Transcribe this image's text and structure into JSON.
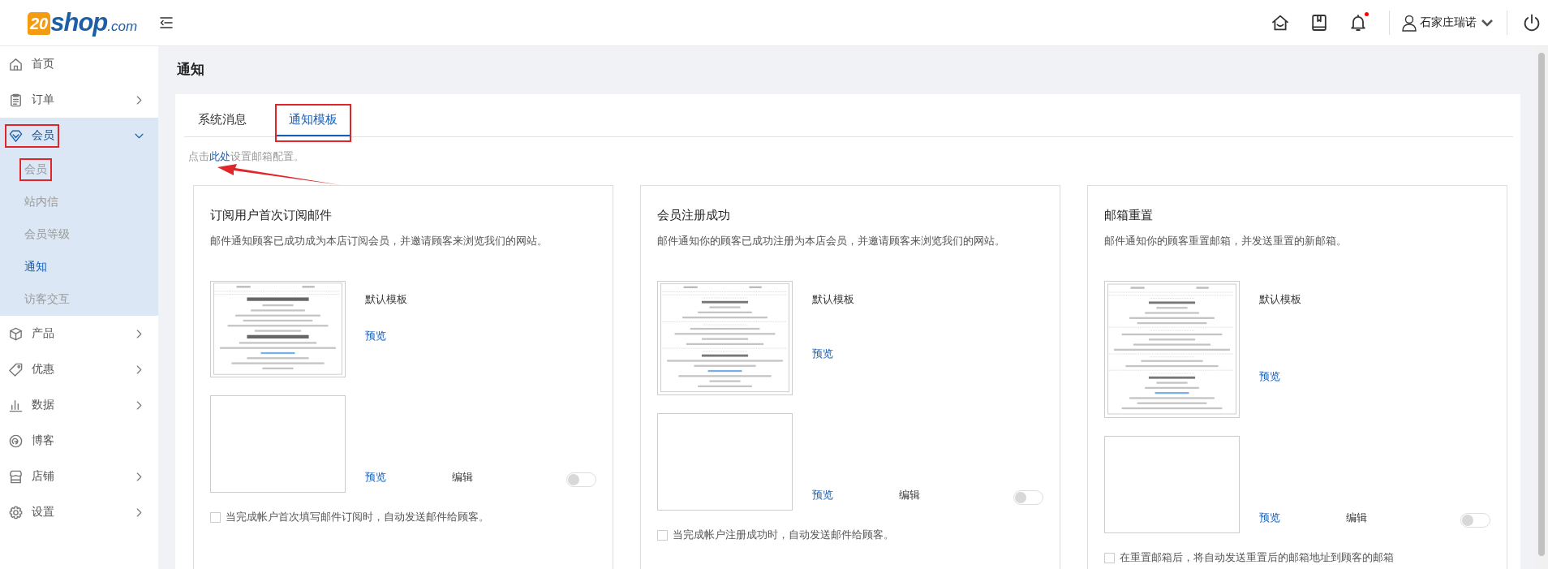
{
  "header": {
    "logo": {
      "badge": "20",
      "name": "shop",
      "suffix": ".com"
    },
    "notifications_unread": true,
    "user": "石家庄瑞诺"
  },
  "sidebar": {
    "items": [
      {
        "label": "首页",
        "expandable": false,
        "expanded": false,
        "marked": false
      },
      {
        "label": "订单",
        "expandable": true,
        "expanded": false,
        "marked": false
      },
      {
        "label": "会员",
        "expandable": true,
        "expanded": true,
        "marked": true,
        "children": [
          {
            "label": "会员",
            "selected": false,
            "marked": true
          },
          {
            "label": "站内信",
            "selected": false,
            "marked": false
          },
          {
            "label": "会员等级",
            "selected": false,
            "marked": false
          },
          {
            "label": "通知",
            "selected": true,
            "marked": false
          },
          {
            "label": "访客交互",
            "selected": false,
            "marked": false
          }
        ]
      },
      {
        "label": "产品",
        "expandable": true,
        "expanded": false,
        "marked": false
      },
      {
        "label": "优惠",
        "expandable": true,
        "expanded": false,
        "marked": false
      },
      {
        "label": "数据",
        "expandable": true,
        "expanded": false,
        "marked": false
      },
      {
        "label": "博客",
        "expandable": false,
        "expanded": false,
        "marked": false
      },
      {
        "label": "店铺",
        "expandable": true,
        "expanded": false,
        "marked": false
      },
      {
        "label": "设置",
        "expandable": true,
        "expanded": false,
        "marked": false
      }
    ]
  },
  "page": {
    "title": "通知"
  },
  "tabs": [
    {
      "label": "系统消息",
      "selected": false,
      "marked": false
    },
    {
      "label": "通知模板",
      "selected": true,
      "marked": true
    }
  ],
  "hint": {
    "before": "点击",
    "link": "此处",
    "after": "设置邮箱配置。",
    "arrow": true
  },
  "cards": [
    {
      "title": "订阅用户首次订阅邮件",
      "description": "邮件通知顾客已成功成为本店订阅会员，并邀请顾客来浏览我们的网站。",
      "template_label": "默认模板",
      "preview_1": "预览",
      "preview_2": "预览",
      "edit": "编辑",
      "toggle_on": false,
      "auto_send": {
        "label": "当完成帐户首次填写邮件订阅时，自动发送邮件给顾客。",
        "checked": false
      }
    },
    {
      "title": "会员注册成功",
      "description": "邮件通知你的顾客已成功注册为本店会员，并邀请顾客来浏览我们的网站。",
      "template_label": "默认模板",
      "preview_1": "预览",
      "preview_2": "预览",
      "edit": "编辑",
      "toggle_on": false,
      "auto_send": {
        "label": "当完成帐户注册成功时，自动发送邮件给顾客。",
        "checked": false
      }
    },
    {
      "title": "邮箱重置",
      "description": "邮件通知你的顾客重置邮箱，并发送重置的新邮箱。",
      "template_label": "默认模板",
      "preview_1": "预览",
      "preview_2": "预览",
      "edit": "编辑",
      "toggle_on": false,
      "auto_send": {
        "label": "在重置邮箱后，将自动发送重置后的邮箱地址到顾客的邮箱",
        "checked": false
      }
    }
  ]
}
